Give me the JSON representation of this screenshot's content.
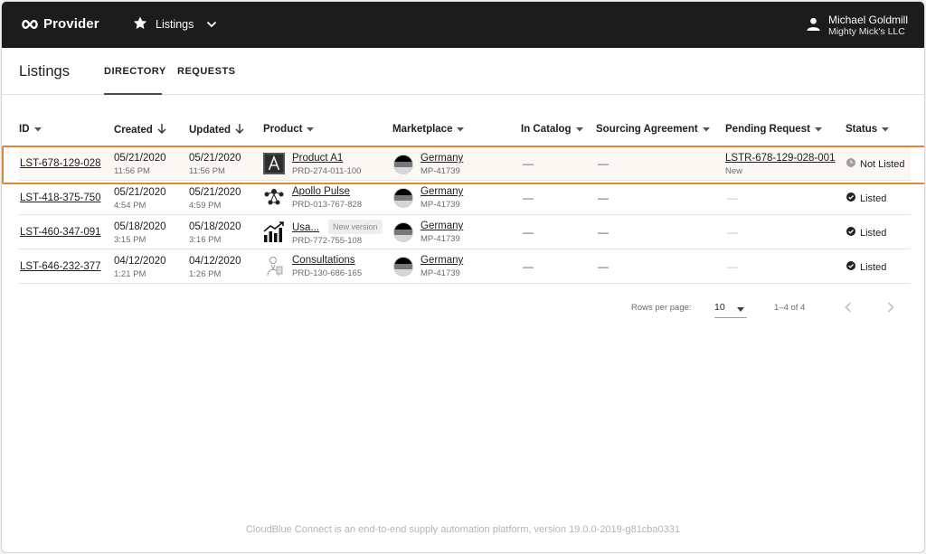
{
  "app": {
    "brand": "Provider",
    "module": "Listings",
    "user_name": "Michael Goldmill",
    "user_org": "Mighty Mick's LLC"
  },
  "page": {
    "title": "Listings",
    "tabs": [
      "DIRECTORY",
      "REQUESTS"
    ],
    "active_tab": "DIRECTORY"
  },
  "table": {
    "columns": [
      "ID",
      "Created",
      "Updated",
      "Product",
      "Marketplace",
      "In Catalog",
      "Sourcing Agreement",
      "Pending Request",
      "Status"
    ],
    "rows": [
      {
        "id": "LST-678-129-028",
        "created_date": "05/21/2020",
        "created_time": "11:56 PM",
        "updated_date": "05/21/2020",
        "updated_time": "11:56 PM",
        "product_name": "Product A1",
        "product_id": "PRD-274-011-100",
        "product_icon": "letter-a-icon",
        "product_badge": "",
        "marketplace": "Germany",
        "marketplace_id": "MP-41739",
        "in_catalog": "—",
        "sourcing_agreement": "—",
        "pending_request": "LSTR-678-129-028-001",
        "pending_status": "New",
        "status": "Not Listed",
        "status_icon": "clock-icon"
      },
      {
        "id": "LST-418-375-750",
        "created_date": "05/21/2020",
        "created_time": "4:54 PM",
        "updated_date": "05/21/2020",
        "updated_time": "4:59 PM",
        "product_name": "Apollo Pulse",
        "product_id": "PRD-013-767-828",
        "product_icon": "people-network-icon",
        "product_badge": "",
        "marketplace": "Germany",
        "marketplace_id": "MP-41739",
        "in_catalog": "—",
        "sourcing_agreement": "—",
        "pending_request": "—",
        "pending_status": "",
        "status": "Listed",
        "status_icon": "check-circle-icon"
      },
      {
        "id": "LST-460-347-091",
        "created_date": "05/18/2020",
        "created_time": "3:15 PM",
        "updated_date": "05/18/2020",
        "updated_time": "3:16 PM",
        "product_name": "Usa...",
        "product_id": "PRD-772-755-108",
        "product_icon": "bar-chart-icon",
        "product_badge": "New version",
        "marketplace": "Germany",
        "marketplace_id": "MP-41739",
        "in_catalog": "—",
        "sourcing_agreement": "—",
        "pending_request": "—",
        "pending_status": "",
        "status": "Listed",
        "status_icon": "check-circle-icon"
      },
      {
        "id": "LST-646-232-377",
        "created_date": "04/12/2020",
        "created_time": "1:21 PM",
        "updated_date": "04/12/2020",
        "updated_time": "1:26 PM",
        "product_name": "Consultations",
        "product_id": "PRD-130-686-165",
        "product_icon": "consultant-icon",
        "product_badge": "",
        "marketplace": "Germany",
        "marketplace_id": "MP-41739",
        "in_catalog": "—",
        "sourcing_agreement": "—",
        "pending_request": "—",
        "pending_status": "",
        "status": "Listed",
        "status_icon": "check-circle-icon"
      }
    ]
  },
  "pagination": {
    "rows_per_page_label": "Rows per page:",
    "rows_per_page": "10",
    "range": "1–4 of 4"
  },
  "footer": "CloudBlue Connect is an end-to-end supply automation platform, version 19.0.0-2019-g81cba0331",
  "colors": {
    "topbar": "#1c1c1c",
    "highlight_border": "#d98a3d",
    "highlight_fill": "#fbf8f3"
  }
}
